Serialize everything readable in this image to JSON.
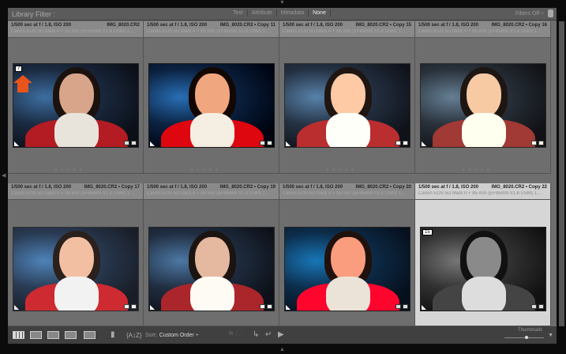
{
  "filter_bar": {
    "title": "Library Filter :",
    "tabs": [
      "Text",
      "Attribute",
      "Metadata",
      "None"
    ],
    "active_tab": "None",
    "filters_off": "Filters Off ÷"
  },
  "cells": [
    {
      "exposure": "1/500 sec at f / 1.8, ISO 200",
      "file": "IMG_8020.CR2",
      "camera": "Canon EOS 5D Mark II + 85 mm (EF85mm f/1.8 USM)   1...",
      "index": "7"
    },
    {
      "exposure": "1/500 sec at f / 1.8, ISO 200",
      "file": "IMG_8020.CR2 • Copy 11",
      "camera": "Canon EOS 5D Mark II + 85 mm (EF85mm f/1.8 USM)   1..."
    },
    {
      "exposure": "1/500 sec at f / 1.8, ISO 200",
      "file": "IMG_8020.CR2 • Copy 15",
      "camera": "Canon EOS 5D Mark II + 85 mm (EF85mm f/1.8 USM)   1..."
    },
    {
      "exposure": "1/500 sec at f / 1.8, ISO 200",
      "file": "IMG_8020.CR2 • Copy 16",
      "camera": "Canon EOS 5D Mark II + 85 mm (EF85mm f/1.8 USM)   1..."
    },
    {
      "exposure": "1/500 sec at f / 1.8, ISO 200",
      "file": "IMG_8020.CR2 • Copy 17",
      "camera": "Canon EOS 5D Mark II + 85 mm (EF85mm f/1.8 USM)   1..."
    },
    {
      "exposure": "1/500 sec at f / 1.8, ISO 200",
      "file": "IMG_8020.CR2 • Copy 19",
      "camera": "Canon EOS 5D Mark II + 85 mm (EF85mm f/1.8 USM)   1..."
    },
    {
      "exposure": "1/500 sec at f / 1.8, ISO 200",
      "file": "IMG_8020.CR2 • Copy 20",
      "camera": "Canon EOS 5D Mark II + 85 mm (EF85mm f/1.8 USM)   1..."
    },
    {
      "exposure": "1/500 sec at f / 1.8, ISO 200",
      "file": "IMG_8020.CR2 • Copy 22",
      "camera": "Canon EOS 5D Mark II + 85 mm (EF85mm f/1.8 USM)   1...",
      "index": "15"
    }
  ],
  "rating_dots": "• • • • •",
  "toolbar": {
    "sort_label": "Sort:",
    "sort_value": "Custom Order ÷",
    "thumbnails_label": "Thumbnails",
    "thumbnail_size": 0.55
  },
  "colors": {
    "accent_arrow": "#e8541c",
    "selected_cell": "#d6d6d6"
  }
}
